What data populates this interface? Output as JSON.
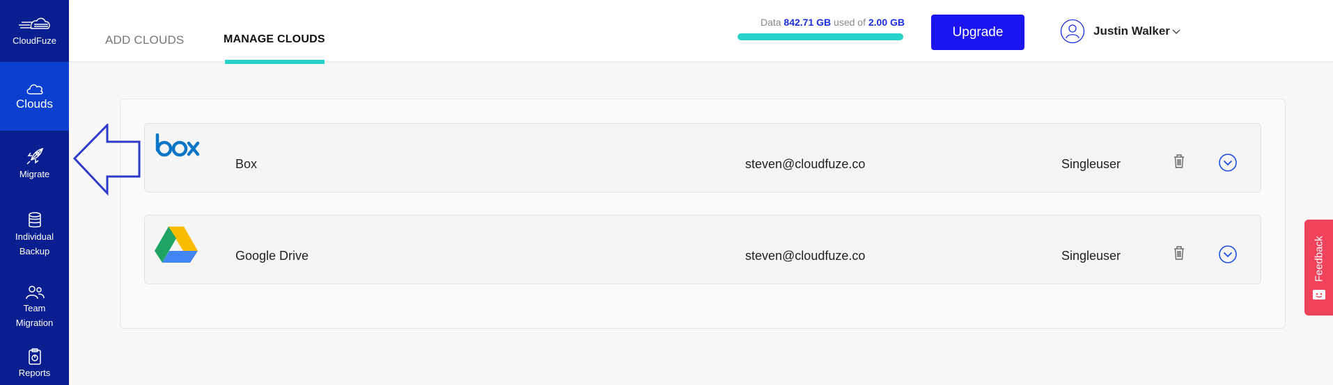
{
  "brand": {
    "name": "CloudFuze"
  },
  "sidebar": {
    "items": [
      {
        "label": "Clouds",
        "icon": "cloud-icon",
        "active": true
      },
      {
        "label": "Migrate",
        "icon": "rocket-icon",
        "active": false
      },
      {
        "label": "Individual Backup",
        "icon": "database-icon",
        "active": false
      },
      {
        "label": "Team Migration",
        "icon": "users-icon",
        "active": false
      },
      {
        "label": "Reports",
        "icon": "clipboard-icon",
        "active": false
      }
    ]
  },
  "tabs": [
    {
      "label": "ADD CLOUDS",
      "active": false
    },
    {
      "label": "MANAGE CLOUDS",
      "active": true
    }
  ],
  "usage": {
    "prefix": "Data",
    "used": "842.71 GB",
    "middle": "used of",
    "total": "2.00 GB"
  },
  "upgrade_label": "Upgrade",
  "user": {
    "name": "Justin Walker"
  },
  "clouds": [
    {
      "name": "Box",
      "email": "steven@cloudfuze.co",
      "type": "Singleuser",
      "logo": "box-logo"
    },
    {
      "name": "Google Drive",
      "email": "steven@cloudfuze.co",
      "type": "Singleuser",
      "logo": "google-drive-logo"
    }
  ],
  "feedback_label": "Feedback",
  "colors": {
    "sidebar": "#0a1f8f",
    "sidebar_active": "#0a3fd0",
    "accent_teal": "#27d3c8",
    "upgrade": "#1a14f0",
    "feedback": "#f0425b"
  }
}
